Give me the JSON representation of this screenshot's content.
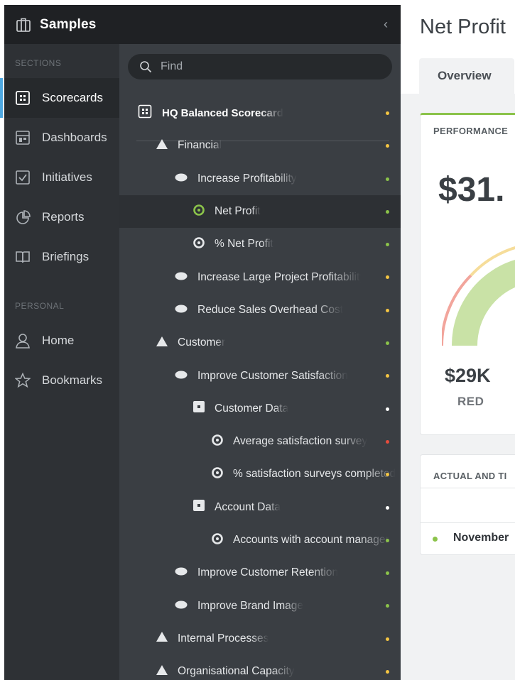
{
  "app": {
    "title": "Samples",
    "collapse": "‹"
  },
  "sections": {
    "heading": "SECTIONS",
    "items": [
      {
        "label": "Scorecards",
        "icon": "scorecard-icon",
        "active": true
      },
      {
        "label": "Dashboards",
        "icon": "dashboard-icon"
      },
      {
        "label": "Initiatives",
        "icon": "checkbox-icon"
      },
      {
        "label": "Reports",
        "icon": "pie-chart-icon"
      },
      {
        "label": "Briefings",
        "icon": "book-icon"
      }
    ]
  },
  "personal": {
    "heading": "PERSONAL",
    "items": [
      {
        "label": "Home",
        "icon": "user-icon"
      },
      {
        "label": "Bookmarks",
        "icon": "star-icon"
      }
    ]
  },
  "search": {
    "placeholder": "Find"
  },
  "tree": [
    {
      "label": "HQ Balanced Scorecard",
      "type": "scorecard",
      "level": 0,
      "status": "#f4c542"
    },
    {
      "label": "Financial",
      "type": "perspective",
      "level": 1,
      "status": "#f4c542"
    },
    {
      "label": "Increase Profitability",
      "type": "objective",
      "level": 2,
      "status": "#8bc34a"
    },
    {
      "label": "Net Profit",
      "type": "measure",
      "level": 3,
      "status": "#8bc34a",
      "active": true
    },
    {
      "label": "% Net Profit",
      "type": "measure",
      "level": 3,
      "status": "#8bc34a"
    },
    {
      "label": "Increase Large Project Profitability",
      "type": "objective",
      "level": 2,
      "status": "#f4c542"
    },
    {
      "label": "Reduce Sales Overhead Cost",
      "type": "objective",
      "level": 2,
      "status": "#f4c542"
    },
    {
      "label": "Customer",
      "type": "perspective",
      "level": 1,
      "status": "#8bc34a"
    },
    {
      "label": "Improve Customer Satisfaction",
      "type": "objective",
      "level": 2,
      "status": "#f4c542"
    },
    {
      "label": "Customer Data",
      "type": "group",
      "level": 3,
      "status": "#ffffff"
    },
    {
      "label": "Average satisfaction survey",
      "type": "measure",
      "level": 4,
      "status": "#e74c3c"
    },
    {
      "label": "% satisfaction surveys completed",
      "type": "measure",
      "level": 4,
      "status": "#f4c542"
    },
    {
      "label": "Account Data",
      "type": "group",
      "level": 3,
      "status": "#ffffff"
    },
    {
      "label": "Accounts with account manager",
      "type": "measure",
      "level": 4,
      "status": "#8bc34a"
    },
    {
      "label": "Improve Customer Retention",
      "type": "objective",
      "level": 2,
      "status": "#8bc34a"
    },
    {
      "label": "Improve Brand Image",
      "type": "objective",
      "level": 2,
      "status": "#8bc34a"
    },
    {
      "label": "Internal Processes",
      "type": "perspective",
      "level": 1,
      "status": "#f4c542"
    },
    {
      "label": "Organisational Capacity",
      "type": "perspective",
      "level": 1,
      "status": "#f4c542"
    }
  ],
  "main": {
    "title": "Net Profit",
    "tab": "Overview",
    "performance": {
      "heading": "PERFORMANCE",
      "value": "$31.",
      "min_value": "$29K",
      "min_label": "RED"
    },
    "actual": {
      "heading": "ACTUAL AND TI",
      "row_month": "November"
    }
  },
  "colors": {
    "green": "#8bc34a",
    "yellow": "#f4c542",
    "red": "#e74c3c",
    "accent": "#4ea8e1"
  }
}
